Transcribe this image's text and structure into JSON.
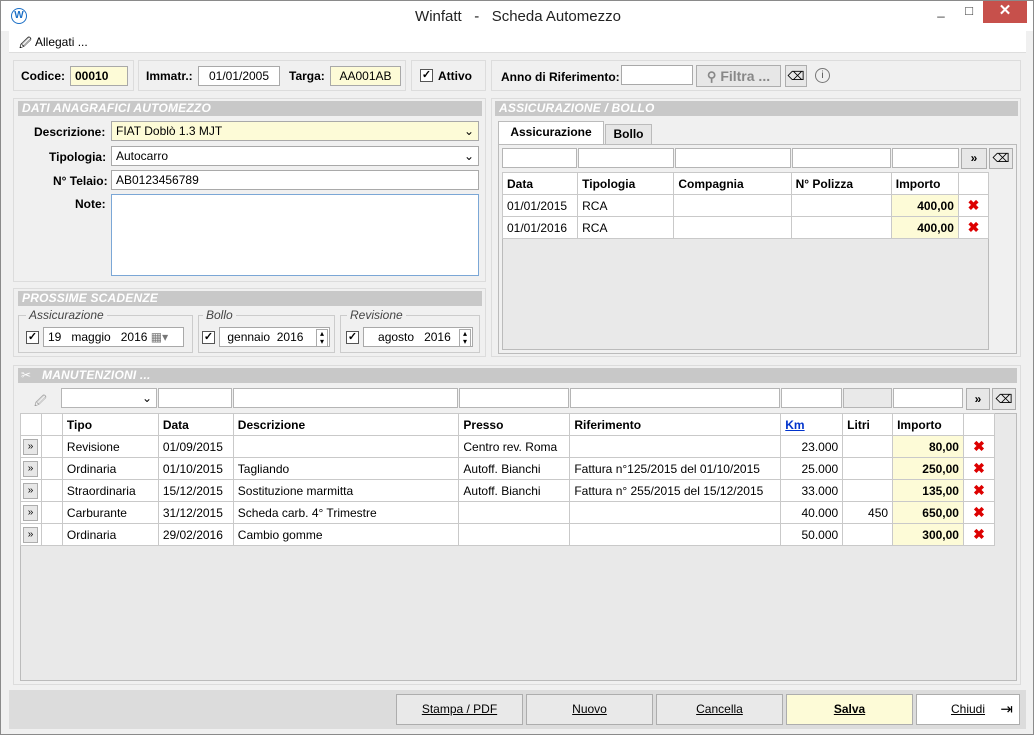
{
  "window": {
    "title": "Winfatt   -   Scheda Automezzo",
    "logo": "W",
    "minimize": "_",
    "maximize": "□",
    "close": "✕"
  },
  "menu": {
    "attachments": "Allegati ..."
  },
  "header": {
    "code_label": "Codice:",
    "code": "00010",
    "reg_label": "Immatr.:",
    "reg_date": "01/01/2005",
    "plate_label": "Targa:",
    "plate": "AA001AB",
    "active_label": "Attivo",
    "year_label": "Anno di Riferimento:",
    "year": "",
    "filter_label": "Filtra ..."
  },
  "registry": {
    "section": "DATI ANAGRAFICI AUTOMEZZO",
    "desc_label": "Descrizione:",
    "desc": "FIAT Doblò 1.3 MJT",
    "type_label": "Tipologia:",
    "type": "Autocarro",
    "chassis_label": "N° Telaio:",
    "chassis": "AB0123456789",
    "notes_label": "Note:",
    "notes": ""
  },
  "deadlines": {
    "section": "PROSSIME SCADENZE",
    "insurance_label": "Assicurazione",
    "insurance_day": "19",
    "insurance_month": "maggio",
    "insurance_year": "2016",
    "tax_label": "Bollo",
    "tax_month": "gennaio",
    "tax_year": "2016",
    "revision_label": "Revisione",
    "revision_month": "agosto",
    "revision_year": "2016"
  },
  "insurance": {
    "section": "ASSICURAZIONE / BOLLO",
    "tabs": [
      "Assicurazione",
      "Bollo"
    ],
    "more": "»",
    "columns": [
      "Data",
      "Tipologia",
      "Compagnia",
      "N° Polizza",
      "Importo"
    ],
    "rows": [
      {
        "date": "01/01/2015",
        "type": "RCA",
        "company": "",
        "policy": "",
        "amount": "400,00"
      },
      {
        "date": "01/01/2016",
        "type": "RCA",
        "company": "",
        "policy": "",
        "amount": "400,00"
      }
    ]
  },
  "maintenance": {
    "section": "MANUTENZIONI ...",
    "more": "»",
    "columns": [
      "Tipo",
      "Data",
      "Descrizione",
      "Presso",
      "Riferimento",
      "Km",
      "Litri",
      "Importo"
    ],
    "rows": [
      {
        "type": "Revisione",
        "date": "01/09/2015",
        "desc": "",
        "at": "Centro rev. Roma",
        "ref": "",
        "km": "23.000",
        "liters": "",
        "amount": "80,00"
      },
      {
        "type": "Ordinaria",
        "date": "01/10/2015",
        "desc": "Tagliando",
        "at": "Autoff. Bianchi",
        "ref": "Fattura n°125/2015 del 01/10/2015",
        "km": "25.000",
        "liters": "",
        "amount": "250,00"
      },
      {
        "type": "Straordinaria",
        "date": "15/12/2015",
        "desc": "Sostituzione marmitta",
        "at": "Autoff. Bianchi",
        "ref": "Fattura n° 255/2015 del 15/12/2015",
        "km": "33.000",
        "liters": "",
        "amount": "135,00"
      },
      {
        "type": "Carburante",
        "date": "31/12/2015",
        "desc": "Scheda carb. 4° Trimestre",
        "at": "",
        "ref": "",
        "km": "40.000",
        "liters": "450",
        "amount": "650,00"
      },
      {
        "type": "Ordinaria",
        "date": "29/02/2016",
        "desc": "Cambio gomme",
        "at": "",
        "ref": "",
        "km": "50.000",
        "liters": "",
        "amount": "300,00"
      }
    ]
  },
  "footer": {
    "print": "Stampa / PDF",
    "new": "Nuovo",
    "delete": "Cancella",
    "save": "Salva",
    "close": "Chiudi"
  }
}
